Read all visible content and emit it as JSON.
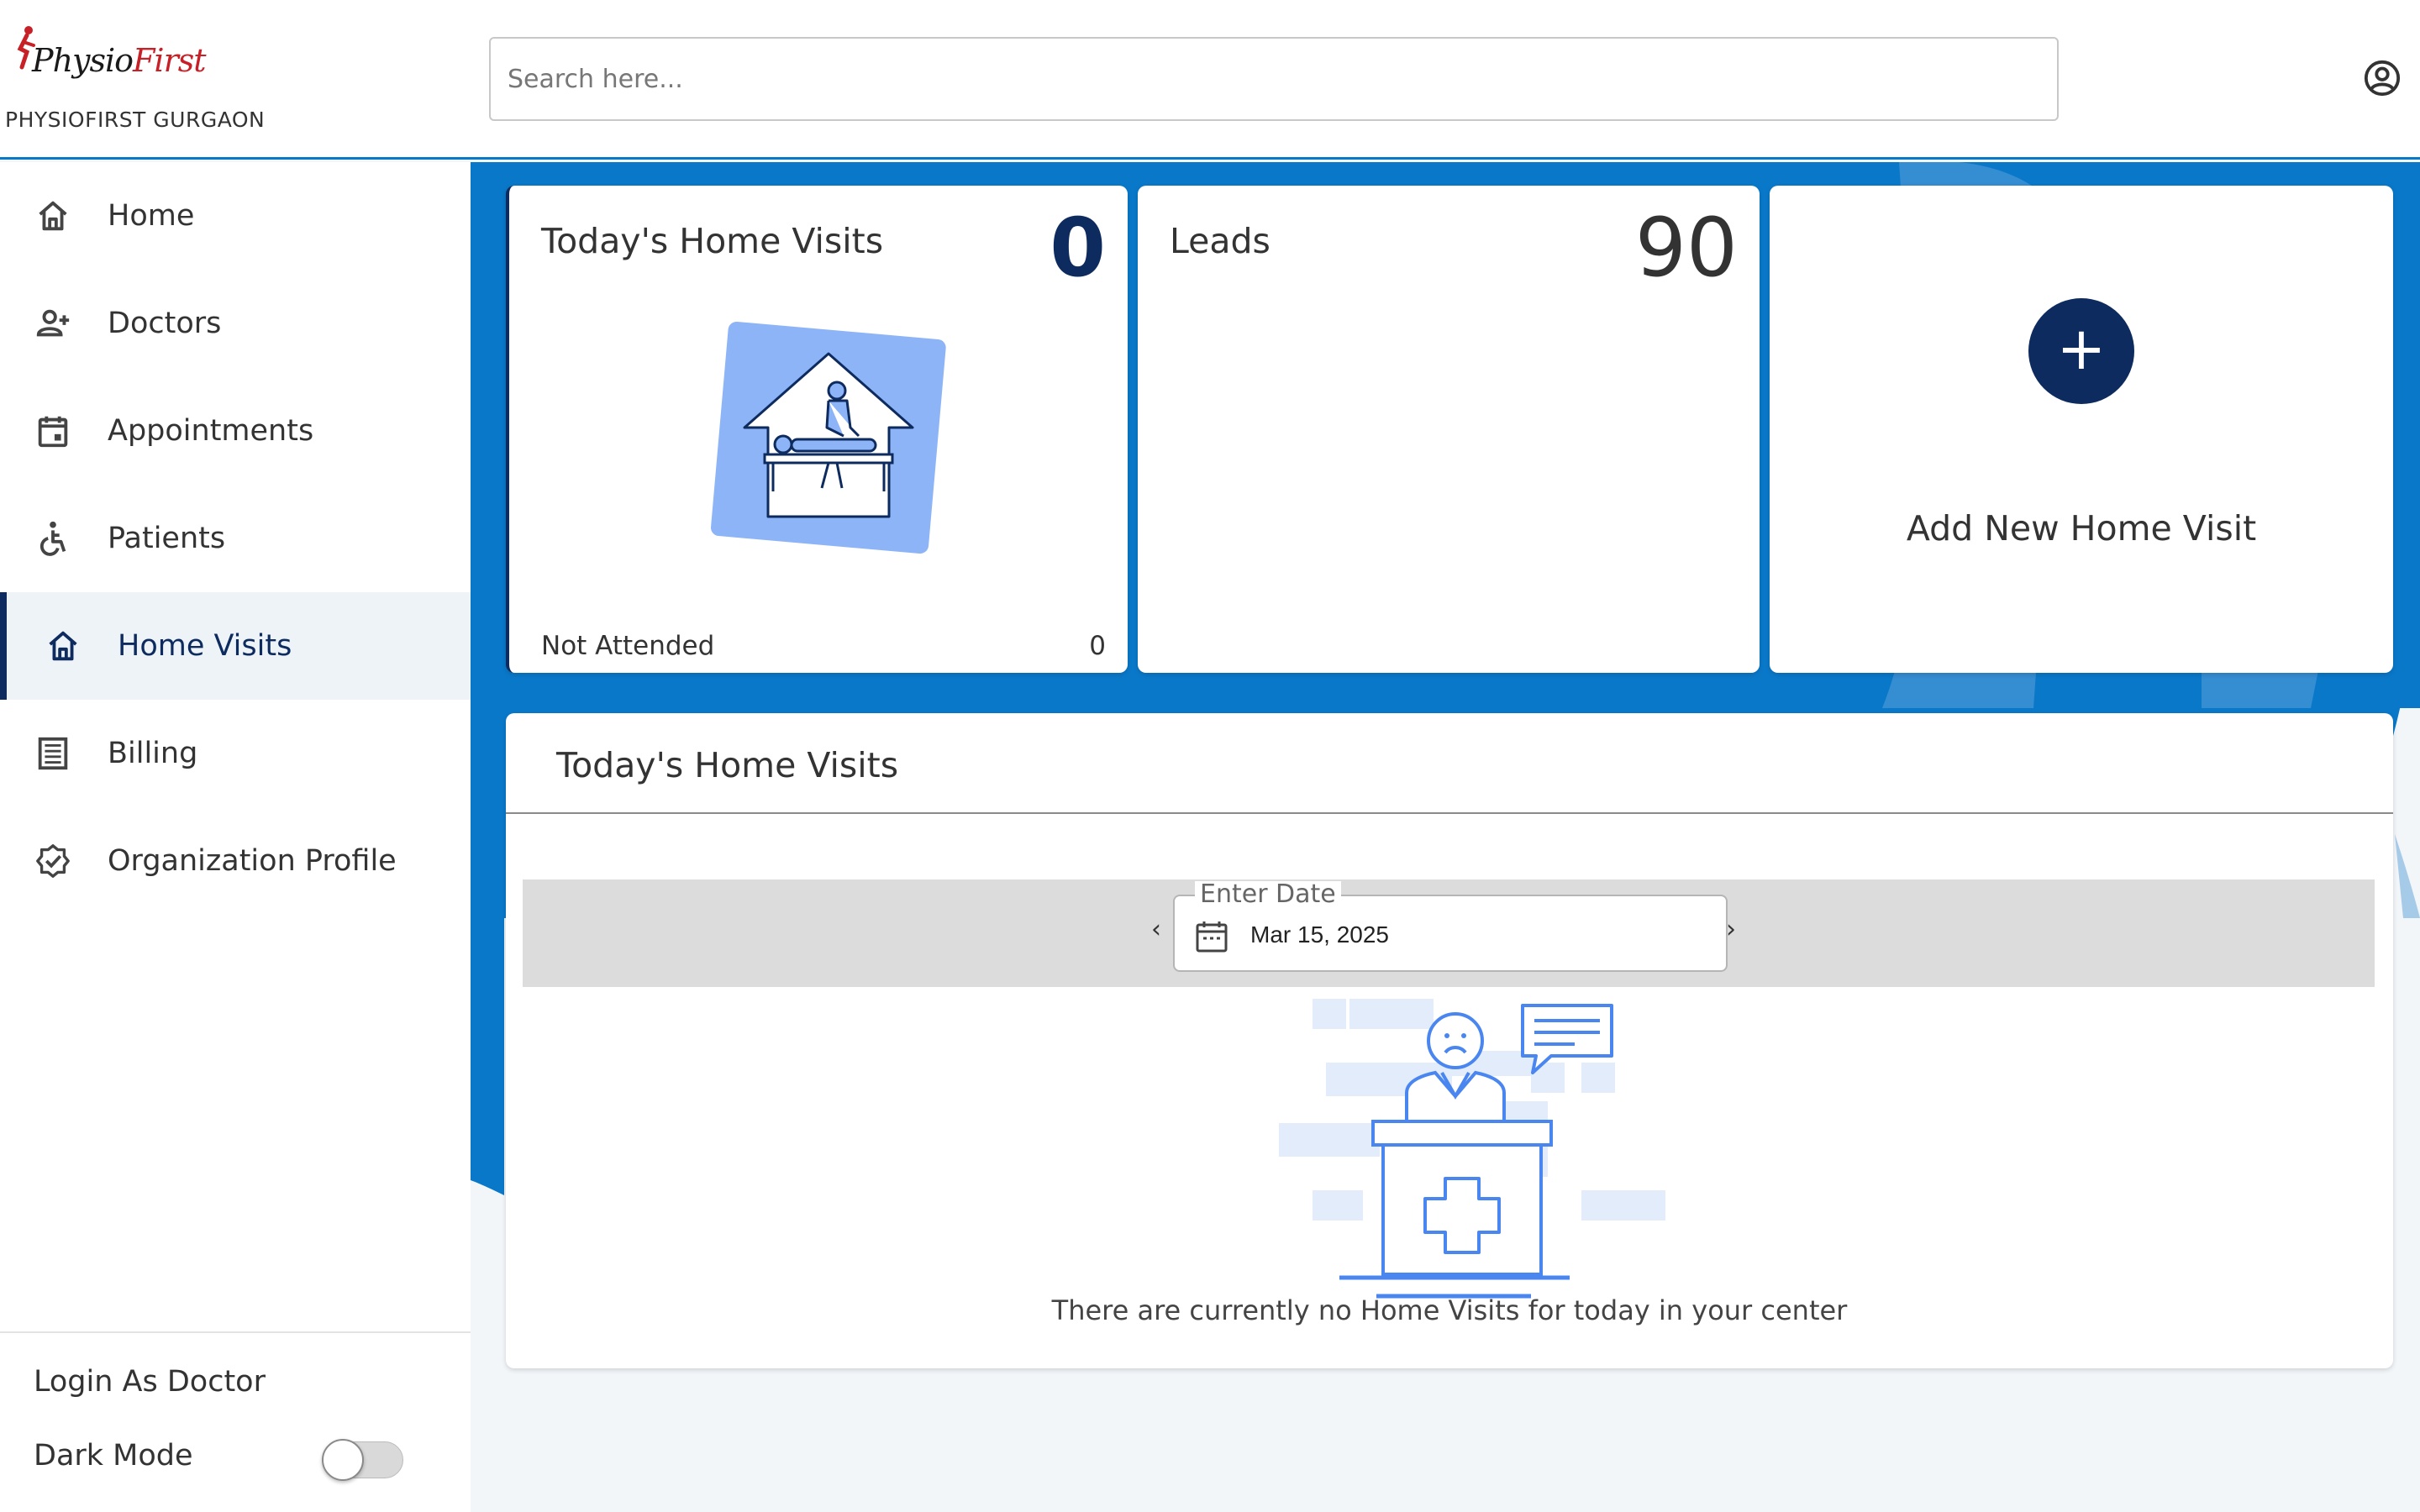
{
  "app": {
    "logo_text_main": "Physio",
    "logo_text_accent": "First",
    "org_name": "PHYSIOFIRST GURGAON"
  },
  "header": {
    "search_placeholder": "Search here...",
    "profile_icon": "account-circle-icon"
  },
  "sidebar": {
    "items": [
      {
        "label": "Home",
        "icon": "home-icon"
      },
      {
        "label": "Doctors",
        "icon": "user-plus-icon"
      },
      {
        "label": "Appointments",
        "icon": "calendar-icon"
      },
      {
        "label": "Patients",
        "icon": "accessible-icon"
      },
      {
        "label": "Home Visits",
        "icon": "home-icon",
        "active": true
      },
      {
        "label": "Billing",
        "icon": "receipt-icon"
      },
      {
        "label": "Organization Profile",
        "icon": "verified-badge-icon"
      }
    ],
    "login_as_doctor": "Login As Doctor",
    "dark_mode_label": "Dark Mode",
    "dark_mode_on": false
  },
  "stats": {
    "home_visits": {
      "title": "Today's Home Visits",
      "count": "0",
      "not_attended_label": "Not Attended",
      "not_attended_value": "0"
    },
    "leads": {
      "title": "Leads",
      "count": "90"
    },
    "add_visit": {
      "label": "Add New Home Visit",
      "button_symbol": "+"
    }
  },
  "panel": {
    "title": "Today's Home Visits",
    "date_label": "Enter Date",
    "date_value": "Mar 15, 2025",
    "prev_symbol": "‹",
    "next_symbol": "›",
    "empty_message": "There are currently no Home Visits for today in your center"
  },
  "colors": {
    "primary": "#0a78c9",
    "navy": "#0d2b5e",
    "accent_light": "#8db4f7",
    "logo_red": "#c72027"
  }
}
